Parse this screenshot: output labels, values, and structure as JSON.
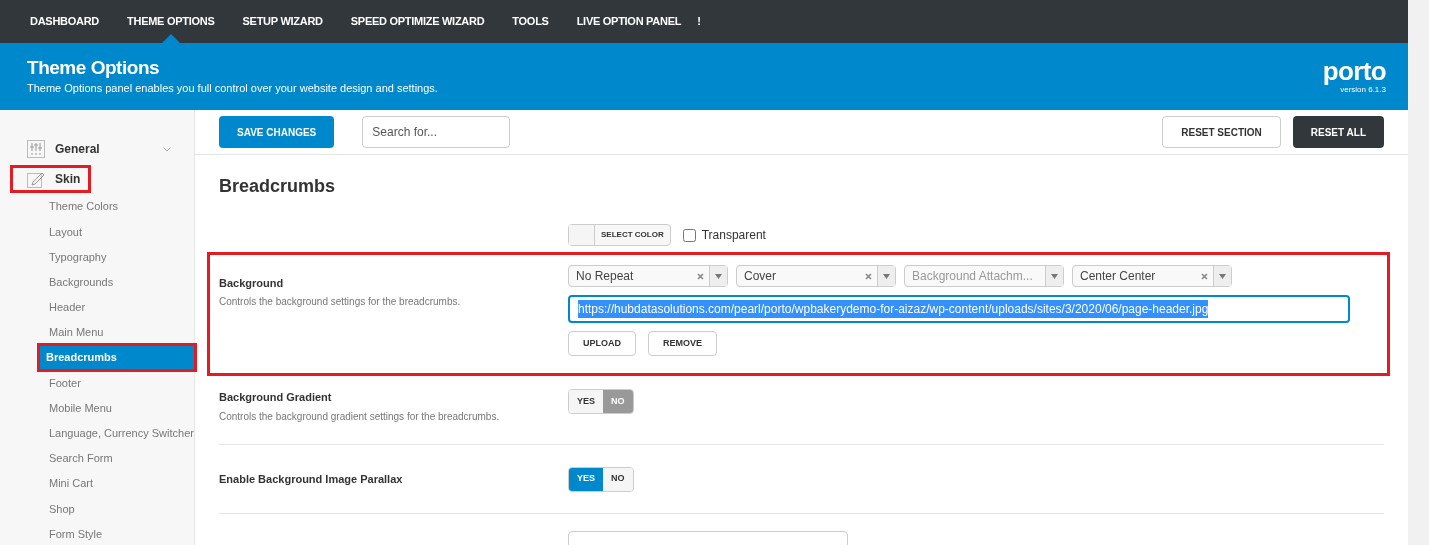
{
  "top_nav": [
    {
      "label": "DASHBOARD",
      "selected": false
    },
    {
      "label": "THEME OPTIONS",
      "selected": true
    },
    {
      "label": "SETUP WIZARD",
      "selected": false
    },
    {
      "label": "SPEED OPTIMIZE WIZARD",
      "selected": false
    },
    {
      "label": "TOOLS",
      "selected": false
    },
    {
      "label": "LIVE OPTION PANEL",
      "selected": false,
      "badge": "!"
    }
  ],
  "header": {
    "title": "Theme Options",
    "subtitle": "Theme Options panel enables you full control over your website design and settings.",
    "logo": "porto",
    "version": "version 6.1.3"
  },
  "sidebar": {
    "sections": [
      {
        "label": "General",
        "expanded": false,
        "highlighted": false
      },
      {
        "label": "Skin",
        "expanded": true,
        "highlighted": true,
        "children": [
          {
            "label": "Theme Colors",
            "selected": false,
            "highlighted": false
          },
          {
            "label": "Layout",
            "selected": false,
            "highlighted": false
          },
          {
            "label": "Typography",
            "selected": false,
            "highlighted": false
          },
          {
            "label": "Backgrounds",
            "selected": false,
            "highlighted": false
          },
          {
            "label": "Header",
            "selected": false,
            "highlighted": false
          },
          {
            "label": "Main Menu",
            "selected": false,
            "highlighted": false
          },
          {
            "label": "Breadcrumbs",
            "selected": true,
            "highlighted": true
          },
          {
            "label": "Footer",
            "selected": false,
            "highlighted": false
          },
          {
            "label": "Mobile Menu",
            "selected": false,
            "highlighted": false
          },
          {
            "label": "Language, Currency Switcher",
            "selected": false,
            "highlighted": false
          },
          {
            "label": "Search Form",
            "selected": false,
            "highlighted": false
          },
          {
            "label": "Mini Cart",
            "selected": false,
            "highlighted": false
          },
          {
            "label": "Shop",
            "selected": false,
            "highlighted": false
          },
          {
            "label": "Form Style",
            "selected": false,
            "highlighted": false
          }
        ]
      }
    ]
  },
  "toolbar": {
    "save": "SAVE CHANGES",
    "search_placeholder": "Search for...",
    "reset_section": "RESET SECTION",
    "reset_all": "RESET ALL"
  },
  "section_title": "Breadcrumbs",
  "color_picker": {
    "label": "SELECT COLOR",
    "transparent_label": "Transparent",
    "transparent_checked": false
  },
  "background": {
    "label": "Background",
    "description": "Controls the background settings for the breadcrumbs.",
    "highlighted": true,
    "selects": [
      {
        "value": "No Repeat"
      },
      {
        "value": "Cover"
      },
      {
        "placeholder": "Background Attachm..."
      },
      {
        "value": "Center Center"
      }
    ],
    "url": "https://hubdatasolutions.com/pearl/porto/wpbakerydemo-for-aizaz/wp-content/uploads/sites/3/2020/06/page-header.jpg",
    "upload": "UPLOAD",
    "remove": "REMOVE"
  },
  "toggles": [
    {
      "label": "Background Gradient",
      "description": "Controls the background gradient settings for the breadcrumbs.",
      "options": [
        {
          "label": "YES",
          "selected": false
        },
        {
          "label": "NO",
          "selected": true
        }
      ]
    },
    {
      "label": "Enable Background Image Parallax",
      "options": [
        {
          "label": "YES",
          "selected": true
        },
        {
          "label": "NO",
          "selected": false
        }
      ]
    }
  ]
}
